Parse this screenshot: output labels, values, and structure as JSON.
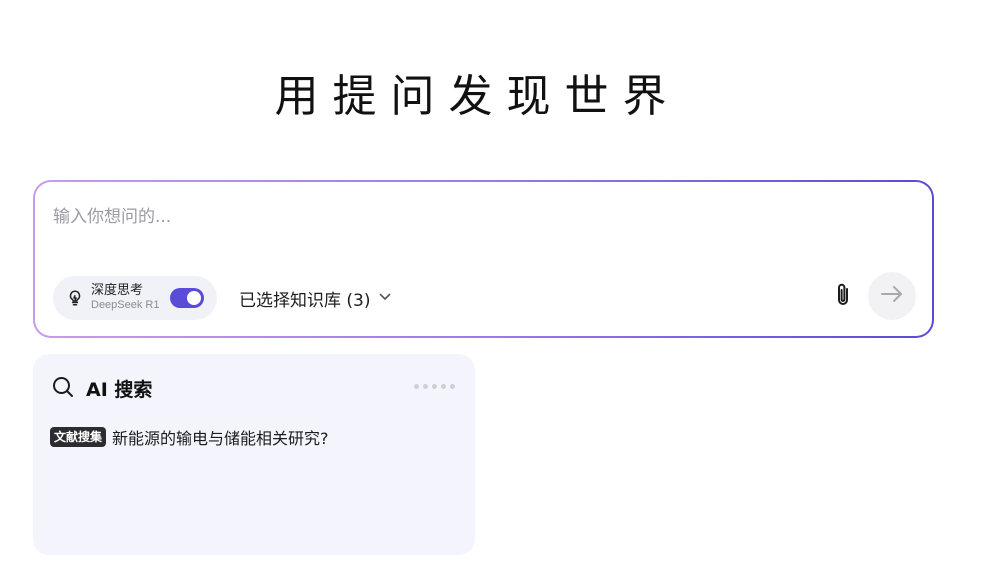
{
  "hero": {
    "title": "用提问发现世界"
  },
  "prompt": {
    "placeholder": "输入你想问的...",
    "deep_think": {
      "title": "深度思考",
      "model": "DeepSeek R1",
      "enabled": true
    },
    "knowledge_base": {
      "label": "已选择知识库 (3)",
      "icon": "chevron-down-icon"
    },
    "attach_icon": "paperclip-icon",
    "send_icon": "arrow-right-icon"
  },
  "card": {
    "title": "AI 搜索",
    "icon": "search-icon",
    "tag": "文献搜集",
    "query": "新能源的输电与储能相关研究?"
  },
  "colors": {
    "accent": "#5a4cd8",
    "border_gradient_start": "#c79bef",
    "border_gradient_end": "#5a4ad8",
    "card_bg": "#f4f5fc"
  }
}
